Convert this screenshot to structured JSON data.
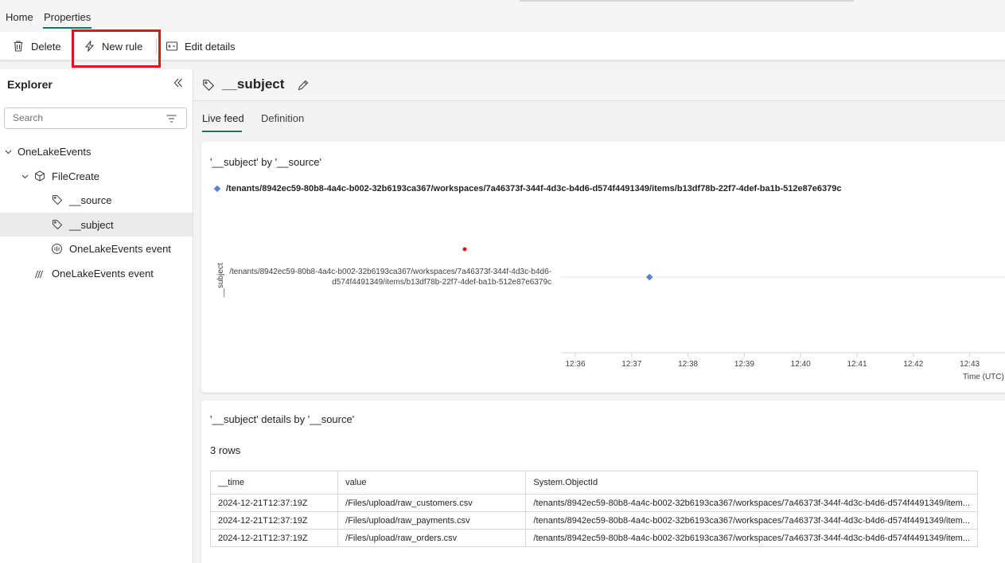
{
  "top_tabs": {
    "home": "Home",
    "properties": "Properties"
  },
  "ribbon": {
    "delete": "Delete",
    "new_rule": "New rule",
    "edit_details": "Edit details"
  },
  "explorer": {
    "title": "Explorer",
    "search_placeholder": "Search",
    "tree": [
      {
        "label": "OneLakeEvents",
        "icon": "chevron-down-icon"
      },
      {
        "label": "FileCreate",
        "icon": "cube-icon"
      },
      {
        "label": "__source",
        "icon": "tag-icon"
      },
      {
        "label": "__subject",
        "icon": "tag-icon",
        "selected": true
      },
      {
        "label": "OneLakeEvents event",
        "icon": "event-icon"
      },
      {
        "label": "OneLakeEvents event",
        "icon": "stream-icon"
      }
    ]
  },
  "entity": {
    "title": "__subject"
  },
  "subtabs": {
    "live_feed": "Live feed",
    "definition": "Definition"
  },
  "chart_card": {
    "title": "'__subject' by '__source'",
    "legend": "/tenants/8942ec59-80b8-4a4c-b002-32b6193ca367/workspaces/7a46373f-344f-4d3c-b4d6-d574f4491349/items/b13df78b-22f7-4def-ba1b-512e87e6379c"
  },
  "chart_data": {
    "type": "scatter",
    "title": "'__subject' by '__source'",
    "xlabel": "Time (UTC)",
    "ylabel": "__subject",
    "x_ticks": [
      "12:36",
      "12:37",
      "12:38",
      "12:39",
      "12:40",
      "12:41",
      "12:42",
      "12:43"
    ],
    "y_categories": [
      "/tenants/8942ec59-80b8-4a4c-b002-32b6193ca367/workspaces/7a46373f-344f-4d3c-b4d6-",
      "d574f4491349/items/b13df78b-22f7-4def-ba1b-512e87e6379c"
    ],
    "series": [
      {
        "name": "/tenants/8942ec59-80b8-4a4c-b002-32b6193ca367/workspaces/7a46373f-344f-4d3c-b4d6-d574f4491349/items/b13df78b-22f7-4def-ba1b-512e87e6379c",
        "color": "#5b7fd6",
        "points": [
          {
            "x": "12:37:19",
            "y": 0
          }
        ]
      }
    ],
    "accent_dot_color": "#e8101a"
  },
  "details_card": {
    "title": "'__subject' details by '__source'",
    "row_count": "3 rows",
    "columns": [
      "__time",
      "value",
      "System.ObjectId"
    ],
    "rows": [
      [
        "2024-12-21T12:37:19Z",
        "/Files/upload/raw_customers.csv",
        "/tenants/8942ec59-80b8-4a4c-b002-32b6193ca367/workspaces/7a46373f-344f-4d3c-b4d6-d574f4491349/item..."
      ],
      [
        "2024-12-21T12:37:19Z",
        "/Files/upload/raw_payments.csv",
        "/tenants/8942ec59-80b8-4a4c-b002-32b6193ca367/workspaces/7a46373f-344f-4d3c-b4d6-d574f4491349/item..."
      ],
      [
        "2024-12-21T12:37:19Z",
        "/Files/upload/raw_orders.csv",
        "/tenants/8942ec59-80b8-4a4c-b002-32b6193ca367/workspaces/7a46373f-344f-4d3c-b4d6-d574f4491349/item..."
      ]
    ]
  },
  "colors": {
    "accent": "#117865",
    "highlight": "#e8101a"
  }
}
